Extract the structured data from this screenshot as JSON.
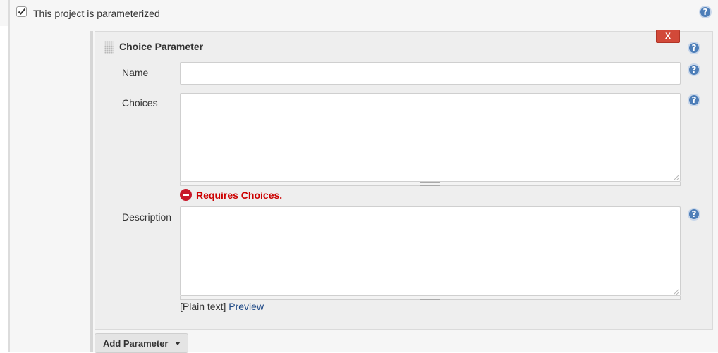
{
  "parameterized": {
    "label": "This project is parameterized",
    "checked": true,
    "help_icon": "help-icon"
  },
  "choice_parameter": {
    "title": "Choice Parameter",
    "delete_label": "X",
    "fields": {
      "name": {
        "label": "Name",
        "value": ""
      },
      "choices": {
        "label": "Choices",
        "value": ""
      },
      "description": {
        "label": "Description",
        "value": ""
      }
    },
    "error": {
      "message": "Requires Choices.",
      "icon": "error-icon"
    },
    "format_note": {
      "prefix": "[Plain text]",
      "link": "Preview"
    }
  },
  "add_parameter": {
    "label": "Add Parameter",
    "icon": "chevron-down-icon"
  },
  "help_glyph": "?",
  "colors": {
    "delete_button": "#d24939",
    "error_text": "#cc0000",
    "link": "#204a87",
    "help_icon": "#4d7eb8"
  }
}
